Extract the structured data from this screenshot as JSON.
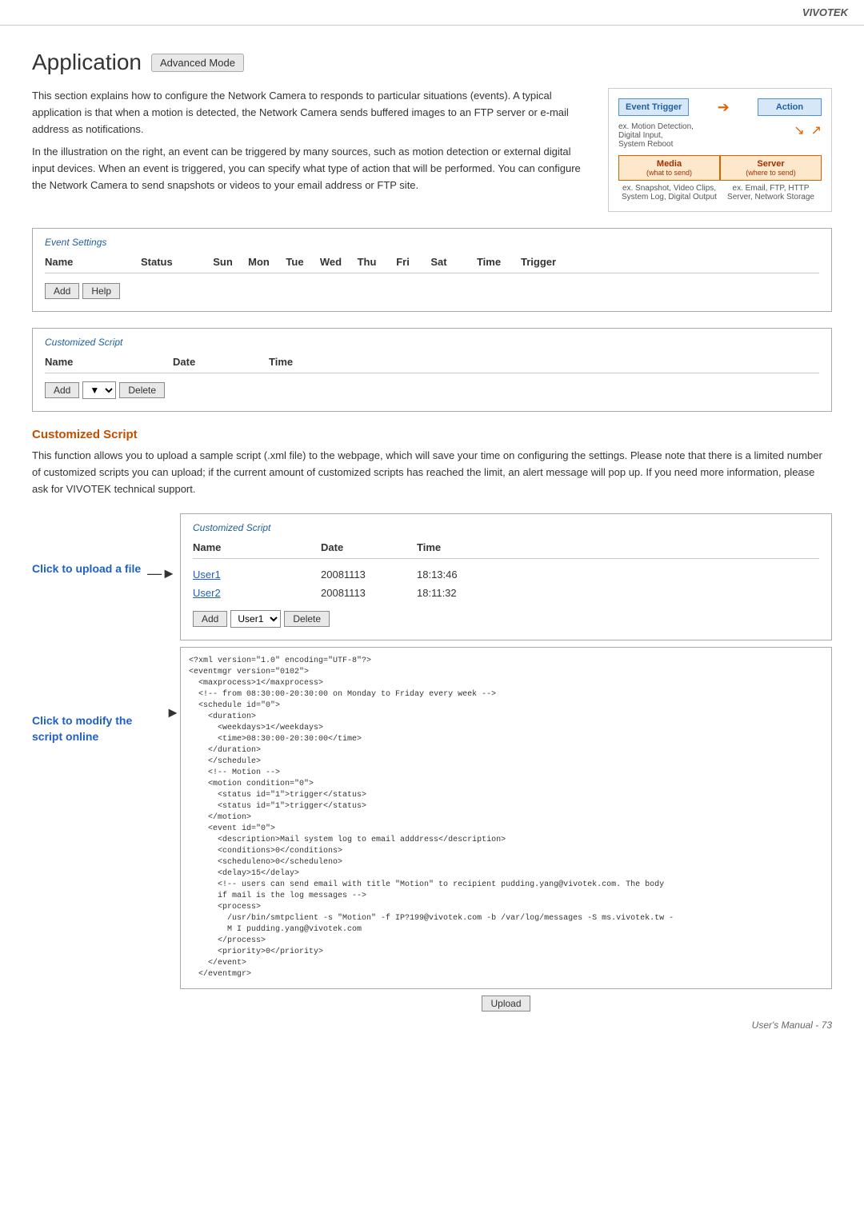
{
  "brand": "VIVOTEK",
  "page": {
    "title": "Application",
    "mode_badge": "Advanced Mode"
  },
  "intro": {
    "paragraph1": "This section explains how to configure the Network Camera to responds to particular situations (events). A typical application is that when a motion is detected, the Network Camera sends buffered images to an FTP server or e-mail address as notifications.",
    "paragraph2": "In the illustration on the right, an event can be triggered by many sources, such as motion detection or external digital input devices. When an event is triggered, you can specify what type of action that will be performed. You can configure the Network Camera to send snapshots or videos to your email address or FTP site."
  },
  "diagram": {
    "event_trigger_label": "Event Trigger",
    "action_label": "Action",
    "ex_trigger": "ex. Motion Detection,\nDigital Input,\nSystem Reboot",
    "media_label": "Media",
    "media_sub": "(what to send)",
    "server_label": "Server",
    "server_sub": "(where to send)",
    "ex_media": "ex. Snapshot, Video Clips,\nSystem Log, Digital Output",
    "ex_server": "ex. Email, FTP, HTTP Server,\nNetwork Storage"
  },
  "event_settings": {
    "panel_title": "Event Settings",
    "columns": [
      "Name",
      "Status",
      "Sun",
      "Mon",
      "Tue",
      "Wed",
      "Thu",
      "Fri",
      "Sat",
      "Time",
      "Trigger"
    ],
    "buttons": {
      "add": "Add",
      "help": "Help"
    }
  },
  "customized_script_panel": {
    "panel_title": "Customized Script",
    "columns": [
      "Name",
      "Date",
      "Time"
    ],
    "buttons": {
      "add": "Add",
      "delete": "Delete"
    }
  },
  "customized_script_section": {
    "title": "Customized Script",
    "description": "This function allows you to upload a sample script (.xml file) to the webpage, which will save your time on configuring the settings. Please note that there is a limited number of customized scripts you can upload; if the current amount of customized scripts has reached the limit, an alert message will pop up. If you need more information, please ask for VIVOTEK technical support.",
    "click_upload_label": "Click to upload a file",
    "click_modify_label": "Click to modify the script online",
    "panel_title": "Customized Script",
    "columns": [
      "Name",
      "Date",
      "Time"
    ],
    "rows": [
      {
        "name": "User1",
        "date": "20081113",
        "time": "18:13:46"
      },
      {
        "name": "User2",
        "date": "20081113",
        "time": "18:11:32"
      }
    ],
    "controls": {
      "add": "Add",
      "user_select": "User1",
      "delete": "Delete"
    },
    "xml_content": "<?xml version=\"1.0\" encoding=\"UTF-8\"?>\n<eventmgr version=\"0102\">\n  <maxprocess>1</maxprocess>\n  <!-- from 08:30:00-20:30:00 on Monday to Friday every week -->\n  <schedule id=\"0\">\n    <duration>\n      <weekdays>1</weekdays>\n      <time>08:30:00-20:30:00</time>\n    </duration>\n    </schedule>\n    <!-- Motion -->\n    <motion condition=\"0\">\n      <status id=\"1\">trigger</status>\n      <status id=\"1\">trigger</status>\n    </motion>\n    <event id=\"0\">\n      <description>Mail system log to email adddress</description>\n      <conditions>0</conditions>\n      <scheduleno>0</scheduleno>\n      <delay>15</delay>\n      <!-- users can send email with title \"Motion\" to recipient pudding.yang@vivotek.com. The body\n      if mail is the log messages -->\n      <process>\n        /usr/bin/smtpclient -s \"Motion\" -f IP?199@vivotek.com -b /var/log/messages -S ms.vivotek.tw -\n        M I pudding.yang@vivotek.com\n      </process>\n      <priority>0</priority>\n    </event>\n  </eventmgr>",
    "upload_btn": "Upload"
  },
  "footer": {
    "text": "User's Manual - 73"
  }
}
